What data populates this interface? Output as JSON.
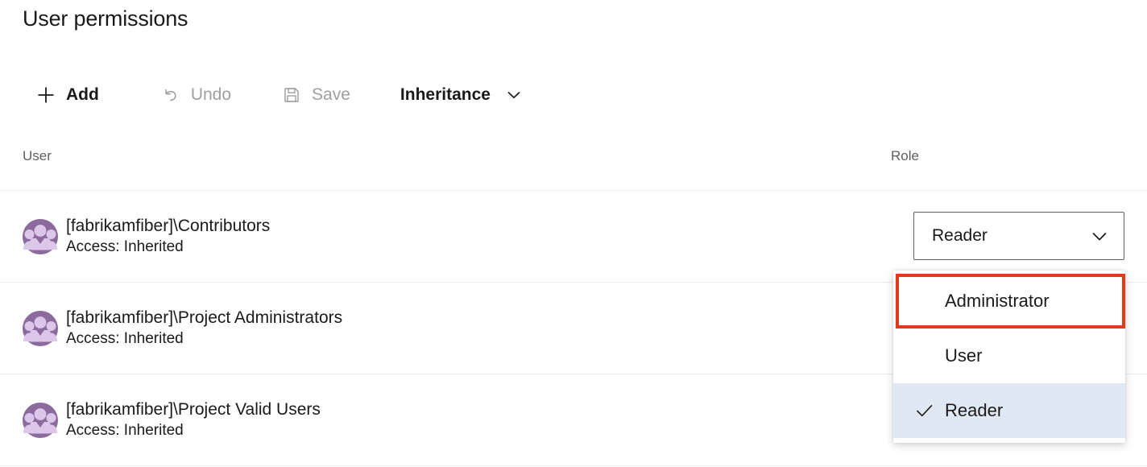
{
  "page": {
    "title": "User permissions"
  },
  "toolbar": {
    "add": {
      "label": "Add",
      "icon": "plus-icon",
      "disabled": false
    },
    "undo": {
      "label": "Undo",
      "icon": "undo-arrow-icon",
      "disabled": true
    },
    "save": {
      "label": "Save",
      "icon": "floppy-disk-icon",
      "disabled": true
    },
    "inheritance": {
      "label": "Inheritance",
      "icon": "chevron-down-icon"
    }
  },
  "table": {
    "columns": {
      "user": "User",
      "role": "Role"
    },
    "rows": [
      {
        "avatar_icon": "group-avatar-icon",
        "name": "[fabrikamfiber]\\Contributors",
        "access": "Access: Inherited",
        "role": "Reader"
      },
      {
        "avatar_icon": "group-avatar-icon",
        "name": "[fabrikamfiber]\\Project Administrators",
        "access": "Access: Inherited",
        "role": ""
      },
      {
        "avatar_icon": "group-avatar-icon",
        "name": "[fabrikamfiber]\\Project Valid Users",
        "access": "Access: Inherited",
        "role": ""
      }
    ]
  },
  "role_dropdown": {
    "selected_value": "Reader",
    "expanded": true,
    "chevron_icon": "chevron-down-icon",
    "check_icon": "checkmark-icon",
    "options": [
      {
        "label": "Administrator",
        "selected": false,
        "highlighted": true
      },
      {
        "label": "User",
        "selected": false,
        "highlighted": false
      },
      {
        "label": "Reader",
        "selected": true,
        "highlighted": false
      }
    ]
  },
  "colors": {
    "annotation": "#e23a18",
    "selected_row_bg": "#dfe8f3",
    "avatar_bg": "#8b6a9c",
    "avatar_fg": "#dcc6ea",
    "border": "#605e5c",
    "divider": "#edebe9",
    "muted_text": "#a19f9d"
  }
}
